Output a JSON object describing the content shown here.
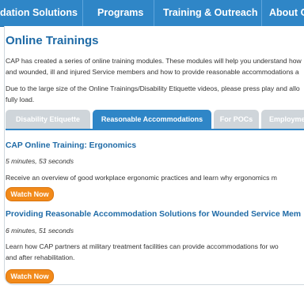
{
  "nav": {
    "items": [
      "dation Solutions",
      "Programs",
      "Training & Outreach",
      "About CAP"
    ],
    "bg_color": "#2f86c7"
  },
  "page": {
    "title": "Online Trainings",
    "intro_line1": "CAP has created a series of online training modules. These modules will help you understand how",
    "intro_line2": "and wounded, ill and injured Service members and how to provide reasonable accommodations a",
    "note_line1": "Due to the large size of the Online Trainings/Disability Etiquette videos, please press play and allo",
    "note_line2": "fully load."
  },
  "tabs": [
    {
      "label": "Disability Etiquette",
      "active": false
    },
    {
      "label": "Reasonable Accommodations",
      "active": true
    },
    {
      "label": "For POCs",
      "active": false
    },
    {
      "label": "Employme",
      "active": false
    }
  ],
  "trainings": [
    {
      "title": "CAP Online Training: Ergonomics",
      "duration": "5 minutes, 53 seconds",
      "desc_line1": "Receive an overview of good workplace ergonomic practices and learn why ergonomics m",
      "desc_line2": "",
      "button": "Watch Now"
    },
    {
      "title": "Providing Reasonable Accommodation Solutions for Wounded Service Mem",
      "duration": "6 minutes, 51 seconds",
      "desc_line1": "Learn how CAP partners at military treatment facilities can provide accommodations for wo",
      "desc_line2": "and after rehabilitation.",
      "button": "Watch Now"
    }
  ],
  "colors": {
    "accent_blue": "#1e6aa6",
    "button_orange": "#f28a1a",
    "tab_inactive": "#cfd5da"
  }
}
